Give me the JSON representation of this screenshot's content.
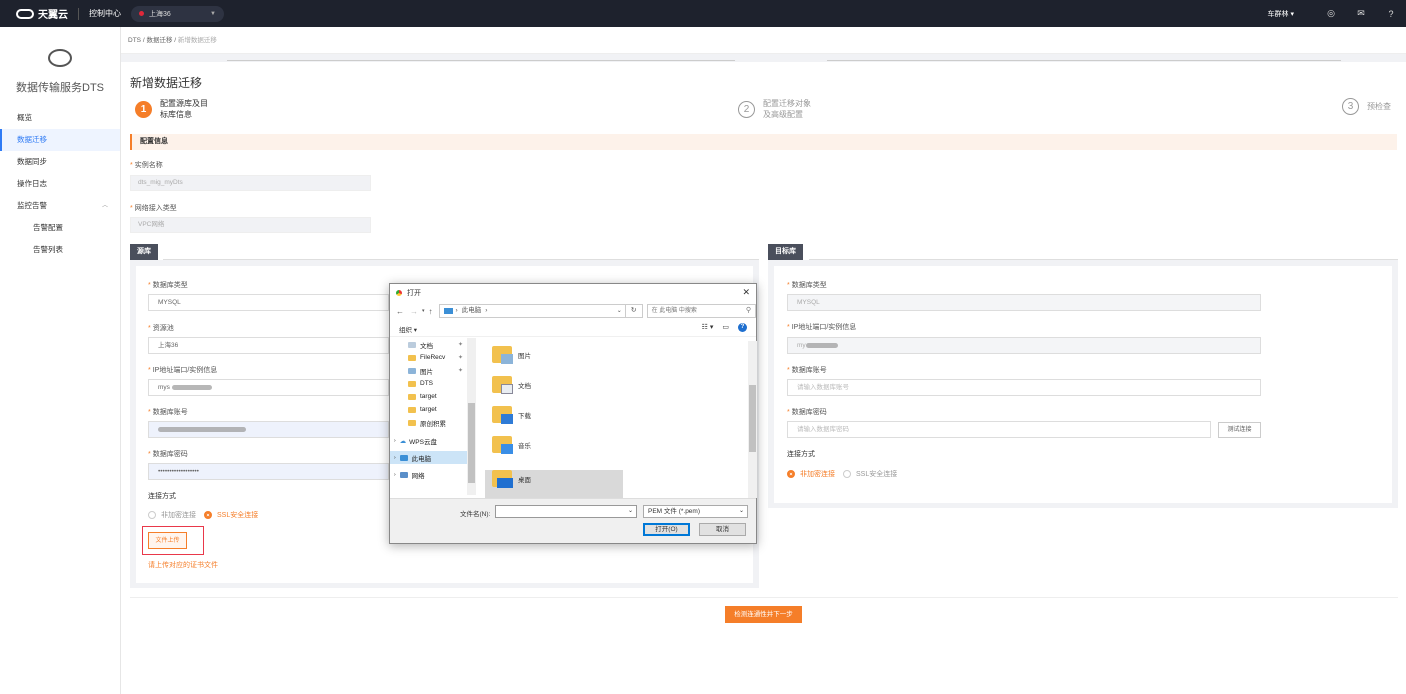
{
  "topbar": {
    "logo_text": "天翼云",
    "console": "控制中心",
    "region": "上海36",
    "user": "车群林",
    "icons": [
      "location-icon",
      "mail-icon",
      "help-icon"
    ]
  },
  "sidebar": {
    "title": "数据传输服务DTS",
    "items": [
      {
        "label": "概览"
      },
      {
        "label": "数据迁移"
      },
      {
        "label": "数据同步"
      },
      {
        "label": "操作日志"
      },
      {
        "label": "监控告警"
      },
      {
        "label": "告警配置"
      },
      {
        "label": "告警列表"
      }
    ]
  },
  "breadcrumb": {
    "items": [
      "DTS",
      "数据迁移",
      "新增数据迁移"
    ],
    "sep": "/"
  },
  "page_title": "新增数据迁移",
  "steps": [
    {
      "num": "1",
      "line1": "配置源库及目",
      "line2": "标库信息"
    },
    {
      "num": "2",
      "line1": "配置迁移对象",
      "line2": "及高级配置"
    },
    {
      "num": "3",
      "line1": "预检查",
      "line2": ""
    }
  ],
  "config": {
    "header": "配置信息",
    "instance_name_label": "实例名称",
    "instance_name_value": "dts_mig_myDts",
    "network_label": "网络接入类型",
    "network_value": "VPC网络"
  },
  "source": {
    "tag": "源库",
    "db_type_label": "数据库类型",
    "db_type_value": "MYSQL",
    "pool_label": "资源池",
    "pool_value": "上海36",
    "ip_label": "IP地址端口/实例信息",
    "ip_value": "mys",
    "account_label": "数据库账号",
    "password_label": "数据库密码",
    "password_value": "••••••••••••••••••",
    "conn_label": "连接方式",
    "conn_opt1": "非加密连接",
    "conn_opt2": "SSL安全连接",
    "upload_btn": "文件上传",
    "upload_hint": "请上传对应的证书文件"
  },
  "target": {
    "tag": "目标库",
    "db_type_label": "数据库类型",
    "db_type_value": "MYSQL",
    "ip_label": "IP地址端口/实例信息",
    "ip_value": "my",
    "account_label": "数据库账号",
    "account_placeholder": "请输入数据库账号",
    "password_label": "数据库密码",
    "password_placeholder": "请输入数据库密码",
    "test_btn": "测试连接",
    "conn_label": "连接方式",
    "conn_opt1": "非加密连接",
    "conn_opt2": "SSL安全连接"
  },
  "next_button": "检测连通性并下一步",
  "dialog": {
    "title": "打开",
    "path_root": "此电脑",
    "search_placeholder": "在 此电脑 中搜索",
    "organize": "组织 ▾",
    "nav_items": [
      {
        "label": "文档",
        "pinned": true
      },
      {
        "label": "FileRecv",
        "pinned": true
      },
      {
        "label": "图片",
        "pinned": true
      },
      {
        "label": "DTS",
        "pinned": false
      },
      {
        "label": "target",
        "pinned": false
      },
      {
        "label": "target",
        "pinned": false
      },
      {
        "label": "原创积累",
        "pinned": false
      },
      {
        "label": "WPS云盘",
        "pinned": false
      },
      {
        "label": "此电脑",
        "pinned": false
      },
      {
        "label": "网络",
        "pinned": false
      }
    ],
    "files": [
      "图片",
      "文档",
      "下载",
      "音乐",
      "桌面"
    ],
    "filename_label": "文件名(N):",
    "filter": "PEM 文件 (*.pem)",
    "open_btn": "打开(O)",
    "cancel_btn": "取消"
  },
  "colors": {
    "accent": "#f57e29",
    "link": "#2f7bf5",
    "topbar": "#1e222d"
  }
}
